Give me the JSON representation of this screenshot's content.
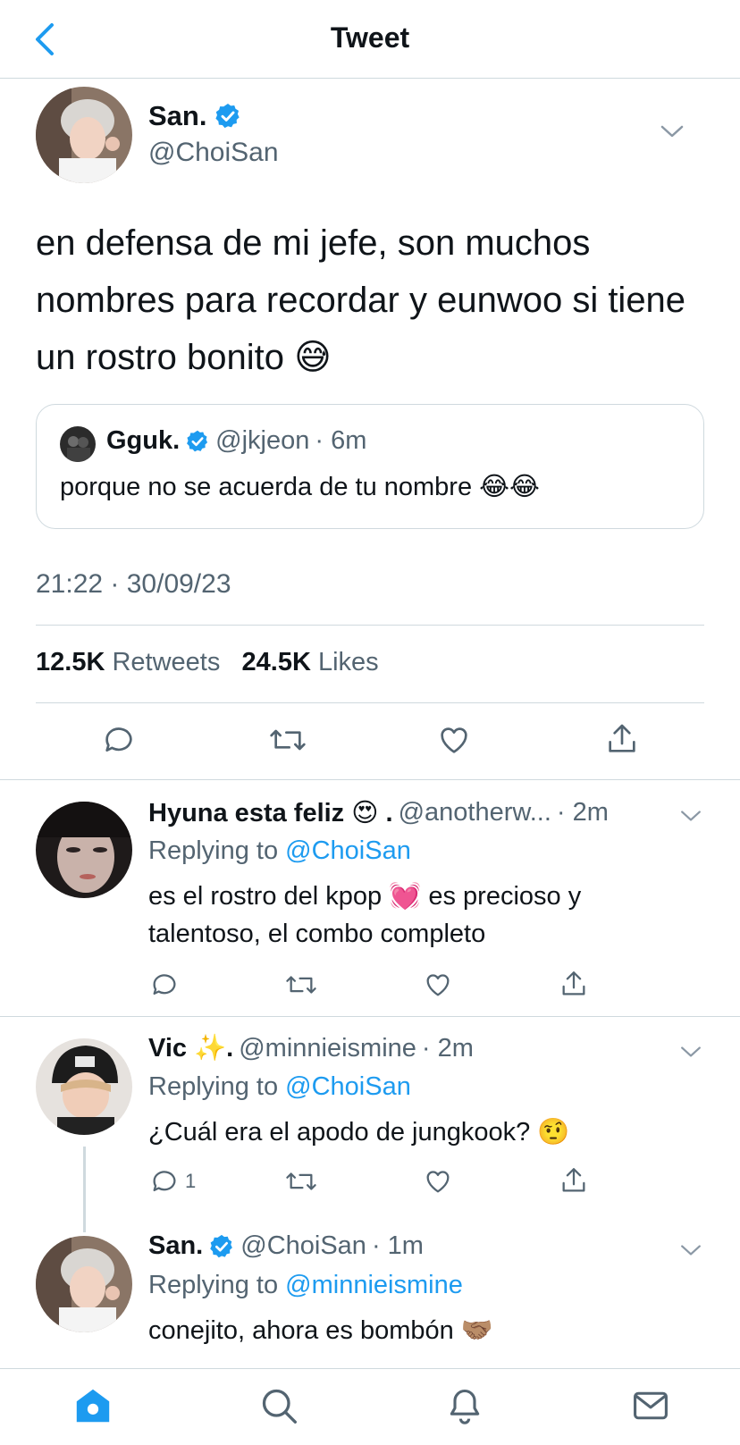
{
  "header": {
    "title": "Tweet"
  },
  "main_tweet": {
    "author_name": "San.",
    "author_handle": "@ChoiSan",
    "text": "en defensa de mi jefe, son muchos nombres para recordar y eunwoo si tiene un rostro bonito 😅",
    "timestamp": "21:22 · 30/09/23",
    "retweets_count": "12.5K",
    "retweets_label": "Retweets",
    "likes_count": "24.5K",
    "likes_label": "Likes"
  },
  "quoted_tweet": {
    "author_name": "Gguk.",
    "author_handle": "@jkjeon",
    "time": "· 6m",
    "text": "porque no se acuerda de tu nombre 😂😂"
  },
  "replies": [
    {
      "author_name": "Hyuna esta feliz 😍 .",
      "author_handle": "@anotherw...",
      "time": "· 2m",
      "replying_prefix": "Replying to",
      "replying_to": "@ChoiSan",
      "text": "es el rostro del kpop 💓 es precioso y talentoso, el combo completo",
      "reply_count": ""
    },
    {
      "author_name": "Vic ✨.",
      "author_handle": "@minnieismine",
      "time": "· 2m",
      "replying_prefix": "Replying to",
      "replying_to": "@ChoiSan",
      "text": "¿Cuál era el apodo de jungkook? 🤨",
      "reply_count": "1"
    },
    {
      "author_name": "San.",
      "author_handle": "@ChoiSan",
      "time": "· 1m",
      "replying_prefix": "Replying to",
      "replying_to": "@minnieismine",
      "text": "conejito, ahora es bombón 🤝🏽",
      "reply_count": ""
    }
  ],
  "colors": {
    "accent": "#1d9bf0",
    "text": "#0f1419",
    "muted": "#536471",
    "border": "#cfd9de"
  },
  "icons": {
    "back": "chevron-left-icon",
    "verified": "verified-badge-icon",
    "more": "chevron-down-icon",
    "reply": "reply-icon",
    "retweet": "retweet-icon",
    "like": "heart-icon",
    "share": "share-icon",
    "home": "home-icon",
    "search": "search-icon",
    "notifications": "bell-icon",
    "messages": "mail-icon"
  }
}
